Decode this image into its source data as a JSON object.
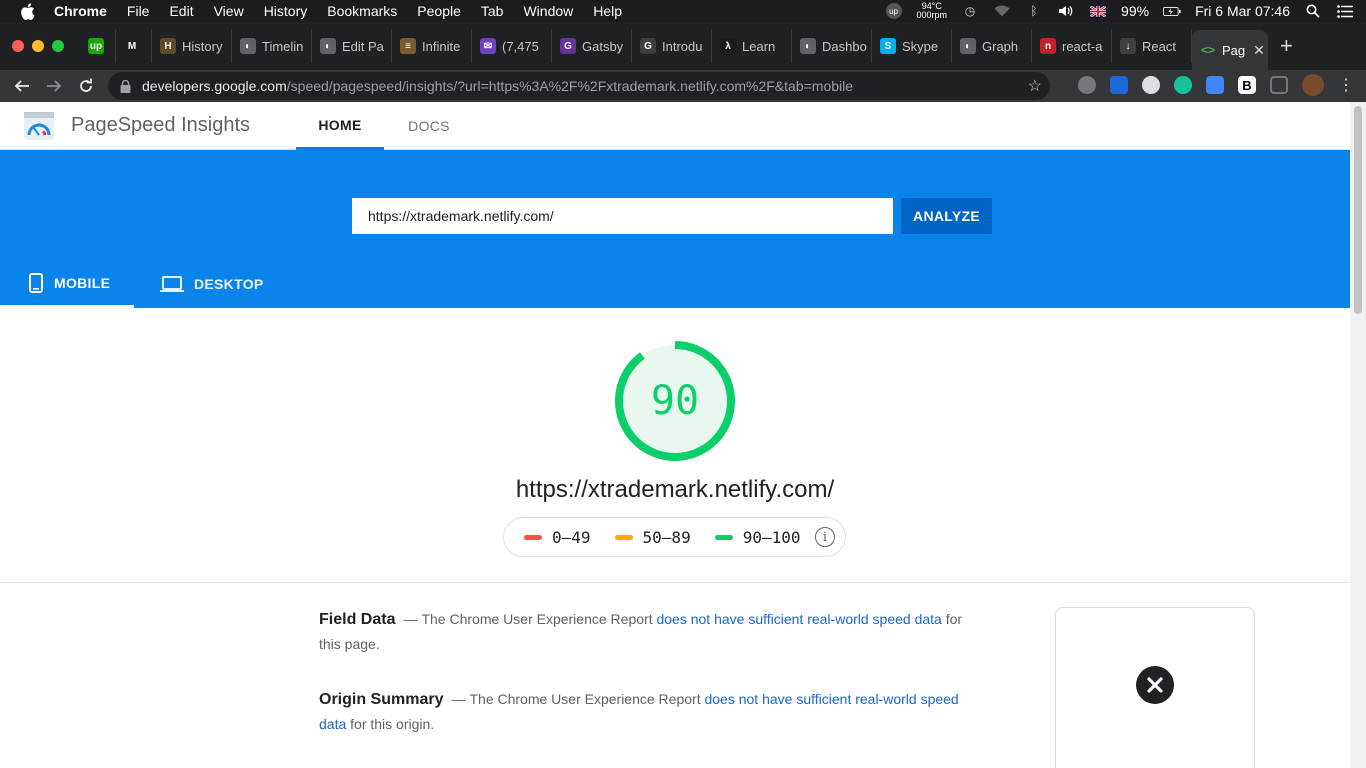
{
  "menubar": {
    "app": "Chrome",
    "items": [
      "File",
      "Edit",
      "View",
      "History",
      "Bookmarks",
      "People",
      "Tab",
      "Window",
      "Help"
    ],
    "temp_top": "94°C",
    "temp_bottom": "000rpm",
    "battery": "99%",
    "datetime": "Fri 6 Mar  07:46"
  },
  "tabs": [
    {
      "label": "",
      "color": "#14a800",
      "icon": "upwork-icon",
      "glyph": "up"
    },
    {
      "label": "",
      "color": "#202124",
      "icon": "gmail-icon",
      "glyph": "M"
    },
    {
      "label": "History",
      "color": "#5f4b2a",
      "icon": "history-icon",
      "glyph": "H"
    },
    {
      "label": "Timelin",
      "color": "#5f6368",
      "icon": "globe-icon",
      "glyph": "◐"
    },
    {
      "label": "Edit Pa",
      "color": "#5f6368",
      "icon": "globe-icon",
      "glyph": "◐"
    },
    {
      "label": "Infinite",
      "color": "#7a5c2e",
      "icon": "site-icon",
      "glyph": "≡"
    },
    {
      "label": "(7,475",
      "color": "#6f42c1",
      "icon": "mail-icon",
      "glyph": "✉"
    },
    {
      "label": "Gatsby",
      "color": "#663399",
      "icon": "gatsby-icon",
      "glyph": "G"
    },
    {
      "label": "Introdu",
      "color": "#3c4043",
      "icon": "doc-icon",
      "glyph": "G"
    },
    {
      "label": "Learn",
      "color": "#1b1b1b",
      "icon": "learn-icon",
      "glyph": "λ"
    },
    {
      "label": "Dashbo",
      "color": "#5f6368",
      "icon": "globe-icon",
      "glyph": "◐"
    },
    {
      "label": "Skype",
      "color": "#00aff0",
      "icon": "skype-icon",
      "glyph": "S"
    },
    {
      "label": "Graph",
      "color": "#5f6368",
      "icon": "globe-icon",
      "glyph": "◐"
    },
    {
      "label": "react-a",
      "color": "#c12127",
      "icon": "npm-icon",
      "glyph": "n"
    },
    {
      "label": "React",
      "color": "#3c4043",
      "icon": "download-icon",
      "glyph": "↓"
    },
    {
      "label": "Pag",
      "color": "#35363a",
      "icon": "pagespeed-icon",
      "glyph": "<>",
      "active": true
    }
  ],
  "address": {
    "host": "developers.google.com",
    "path": "/speed/pagespeed/insights/?url=https%3A%2F%2Fxtrademark.netlify.com%2F&tab=mobile"
  },
  "psi": {
    "brand": "PageSpeed Insights",
    "nav_home": "HOME",
    "nav_docs": "DOCS",
    "url_value": "https://xtrademark.netlify.com/",
    "analyze_label": "ANALYZE",
    "tab_mobile": "MOBILE",
    "tab_desktop": "DESKTOP",
    "score": "90",
    "score_fraction": 0.9,
    "score_color": "#0cce6b",
    "scored_url": "https://xtrademark.netlify.com/",
    "legend": [
      {
        "range": "0–49",
        "color": "#ff4e42"
      },
      {
        "range": "50–89",
        "color": "#ffa400"
      },
      {
        "range": "90–100",
        "color": "#0cce6b"
      }
    ],
    "field_data": {
      "title": "Field Data",
      "dash": "—",
      "pre": "The Chrome User Experience Report ",
      "link": "does not have sufficient real-world speed data",
      "post": " for this page."
    },
    "origin_summary": {
      "title": "Origin Summary",
      "dash": "—",
      "pre": "The Chrome User Experience Report ",
      "link": "does not have sufficient real-world speed data",
      "post": " for this origin."
    }
  }
}
